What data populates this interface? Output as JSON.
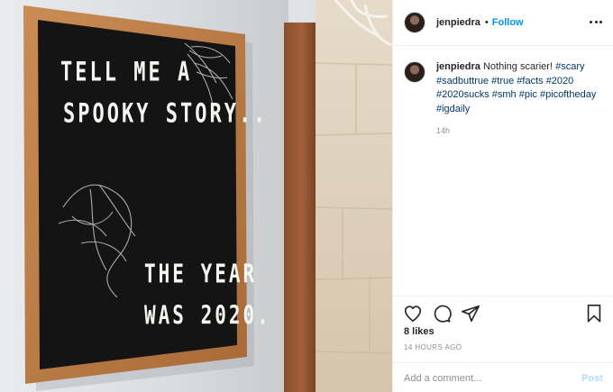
{
  "photo": {
    "board_lines": [
      "TELL ME A",
      "SPOOKY STORY..",
      "THE YEAR",
      "WAS 2020."
    ]
  },
  "header": {
    "username": "jenpiedra",
    "separator": "•",
    "follow_label": "Follow",
    "more_icon": "more-options-icon"
  },
  "caption": {
    "username": "jenpiedra",
    "text": "Nothing scarier!",
    "hashtags": "#scary #sadbuttrue #true #facts #2020 #2020sucks #smh #pic #picoftheday #igdaily",
    "time": "14h"
  },
  "actions": {
    "icons": [
      "heart-icon",
      "comment-icon",
      "share-icon",
      "bookmark-icon"
    ],
    "likes": "8 likes",
    "timestamp": "14 HOURS AGO"
  },
  "comment": {
    "placeholder": "Add a comment...",
    "post_label": "Post"
  },
  "colors": {
    "link_blue": "#0095f6",
    "hashtag_blue": "#00376b",
    "post_disabled": "#b3dbff",
    "secondary_text": "#8e8e8e"
  }
}
